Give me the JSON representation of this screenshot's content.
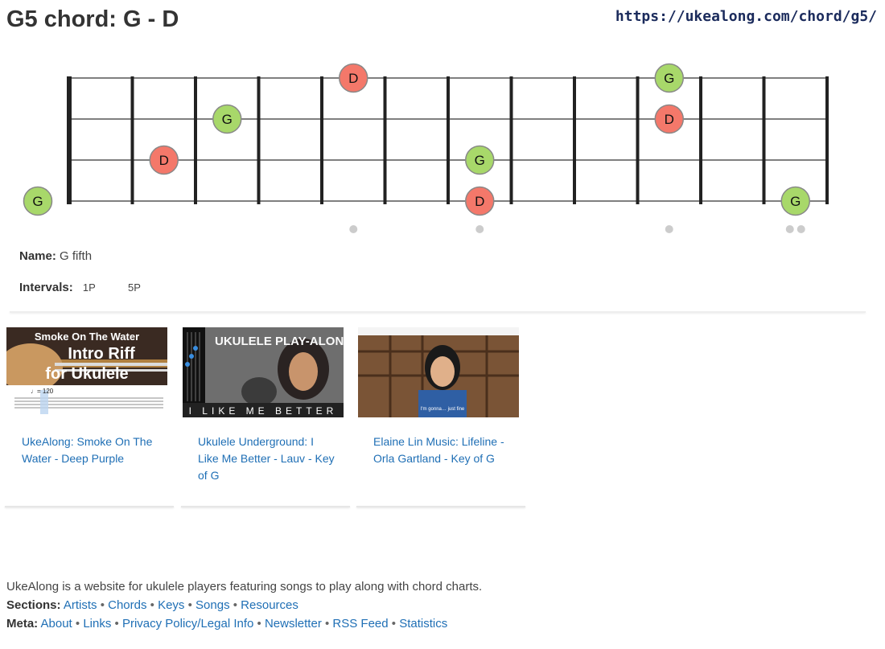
{
  "page": {
    "title": "G5 chord: G - D",
    "url": "https://ukealong.com/chord/g5/"
  },
  "fretboard": {
    "strings": 4,
    "frets": 12,
    "notes": [
      {
        "string": 4,
        "fret": 0,
        "label": "G",
        "type": "root"
      },
      {
        "string": 3,
        "fret": 2,
        "label": "D",
        "type": "fifth"
      },
      {
        "string": 2,
        "fret": 3,
        "label": "G",
        "type": "root"
      },
      {
        "string": 1,
        "fret": 5,
        "label": "D",
        "type": "fifth"
      },
      {
        "string": 3,
        "fret": 7,
        "label": "G",
        "type": "root"
      },
      {
        "string": 4,
        "fret": 7,
        "label": "D",
        "type": "fifth"
      },
      {
        "string": 1,
        "fret": 10,
        "label": "G",
        "type": "root"
      },
      {
        "string": 2,
        "fret": 10,
        "label": "D",
        "type": "fifth"
      },
      {
        "string": 4,
        "fret": 12,
        "label": "G",
        "type": "root"
      }
    ],
    "markers": [
      5,
      7,
      10,
      12
    ],
    "colors": {
      "root": "#a8d86a",
      "fifth": "#f4786a",
      "marker": "#cccccc",
      "string": "#333333",
      "fret": "#222222"
    }
  },
  "info": {
    "name_label": "Name:",
    "name_value": "G fifth",
    "intervals_label": "Intervals:",
    "intervals": [
      "1P",
      "5P"
    ]
  },
  "videos": [
    {
      "title": "UkeAlong: Smoke On The Water - Deep Purple",
      "thumb_caption": "Smoke On The Water Intro Riff for Ukulele",
      "tempo": "♩= 120"
    },
    {
      "title": "Ukulele Underground: I Like Me Better - Lauv - Key of G",
      "thumb_caption_top": "UKULELE PLAY-ALONG",
      "thumb_caption_bottom": "I LIKE ME BETTER"
    },
    {
      "title": "Elaine Lin Music: Lifeline - Orla Gartland - Key of G",
      "thumb_subtitle": "I'm gonna… just fine"
    }
  ],
  "footer": {
    "tagline": "UkeAlong is a website for ukulele players featuring songs to play along with chord charts.",
    "sections_label": "Sections:",
    "sections": [
      "Artists",
      "Chords",
      "Keys",
      "Songs",
      "Resources"
    ],
    "meta_label": "Meta:",
    "meta": [
      "About",
      "Links",
      "Privacy Policy/Legal Info",
      "Newsletter",
      "RSS Feed",
      "Statistics"
    ]
  }
}
